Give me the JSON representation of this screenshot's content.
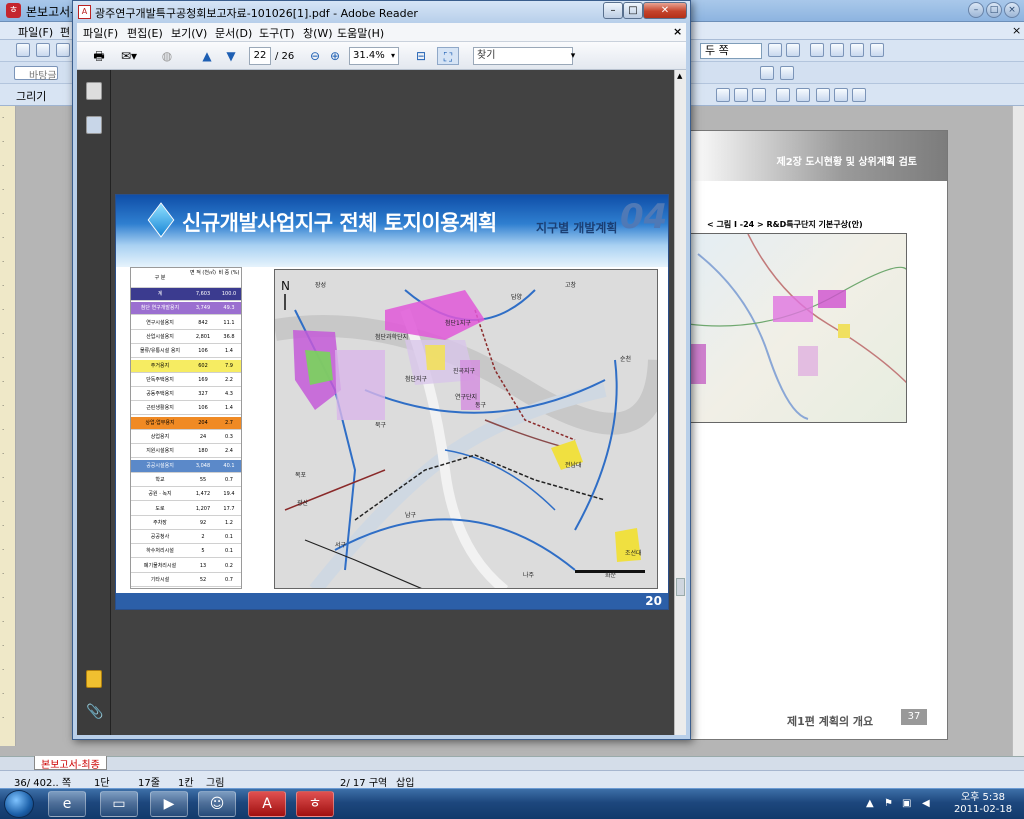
{
  "hwp": {
    "title": "본보고서-",
    "menus": [
      "파일(F)",
      "편"
    ],
    "zoom_option": "두 쪽",
    "style_field": "바탕글",
    "draw_label": "그리기",
    "page_header": "제2장 도시현황 및 상위계획 검토",
    "figure_caption": "< 그림 I -24 > R&D특구단지 기본구상(안)",
    "page_footer": "제1편 계획의 개요",
    "page_number": "37",
    "sheet_tab": "본보고서-최종",
    "status": {
      "page": "36/ 402.. 쪽",
      "column": "1단",
      "line": "17줄",
      "col": "1칸",
      "object": "그림",
      "section": "2/ 17 구역",
      "mode": "삽입"
    }
  },
  "reader": {
    "title": "광주연구개발특구공청회보고자료-101026[1].pdf - Adobe Reader",
    "menus": [
      "파일(F)",
      "편집(E)",
      "보기(V)",
      "문서(D)",
      "도구(T)",
      "창(W)",
      "도움말(H)"
    ],
    "page_current": "22",
    "page_total": "/ 26",
    "zoom": "31.4%",
    "find_placeholder": "찾기",
    "close_x": "×",
    "pdf": {
      "title": "신규개발사업지구 전체 토지이용계획",
      "subtitle": "지구별 개발계획",
      "number": "04",
      "page_number": "20",
      "table_header": [
        "구 분",
        "면 적 (천㎡)",
        "비 중 (%)"
      ],
      "table_rows": [
        {
          "label": "계",
          "area": "7,603",
          "ratio": "100.0",
          "style": "total"
        },
        {
          "label": "첨단 연구개발용지",
          "area": "3,749",
          "ratio": "49.3",
          "style": "purple"
        },
        {
          "label": "연구시설용지",
          "area": "842",
          "ratio": "11.1",
          "style": "plain"
        },
        {
          "label": "산업시설용지",
          "area": "2,801",
          "ratio": "36.8",
          "style": "plain"
        },
        {
          "label": "물류/유통시설 용지",
          "area": "106",
          "ratio": "1.4",
          "style": "plain"
        },
        {
          "label": "주거용지",
          "area": "602",
          "ratio": "7.9",
          "style": "yellow"
        },
        {
          "label": "단독주택용지",
          "area": "169",
          "ratio": "2.2",
          "style": "plain"
        },
        {
          "label": "공동주택용지",
          "area": "327",
          "ratio": "4.3",
          "style": "plain"
        },
        {
          "label": "근린생활용지",
          "area": "106",
          "ratio": "1.4",
          "style": "plain"
        },
        {
          "label": "상업·업무용지",
          "area": "204",
          "ratio": "2.7",
          "style": "orange"
        },
        {
          "label": "상업용지",
          "area": "24",
          "ratio": "0.3",
          "style": "plain"
        },
        {
          "label": "지원시설용지",
          "area": "180",
          "ratio": "2.4",
          "style": "plain"
        },
        {
          "label": "공공시설용지",
          "area": "3,048",
          "ratio": "40.1",
          "style": "blue"
        },
        {
          "label": "학교",
          "area": "55",
          "ratio": "0.7",
          "style": "plain"
        },
        {
          "label": "공원 · 녹지",
          "area": "1,472",
          "ratio": "19.4",
          "style": "plain"
        },
        {
          "label": "도로",
          "area": "1,207",
          "ratio": "17.7",
          "style": "plain"
        },
        {
          "label": "주차장",
          "area": "92",
          "ratio": "1.2",
          "style": "plain"
        },
        {
          "label": "공공청사",
          "area": "2",
          "ratio": "0.1",
          "style": "plain"
        },
        {
          "label": "하수처리시설",
          "area": "5",
          "ratio": "0.1",
          "style": "plain"
        },
        {
          "label": "폐기물처리시설",
          "area": "13",
          "ratio": "0.2",
          "style": "plain"
        },
        {
          "label": "기타시설",
          "area": "52",
          "ratio": "0.7",
          "style": "plain"
        }
      ],
      "map_labels": [
        "첨단과학단지",
        "첨단1지구",
        "첨단지구",
        "진곡지구",
        "연구단지",
        "담양",
        "고창",
        "순천",
        "화순",
        "목포",
        "나주",
        "장성",
        "광산",
        "북구",
        "동구",
        "서구",
        "남구",
        "전남대",
        "조선대"
      ]
    }
  },
  "taskbar": {
    "time": "오후 5:38",
    "date": "2011-02-18"
  },
  "colors": {
    "table_total": "#3b3b8f",
    "table_purple": "#9b6fd0",
    "table_yellow": "#f6ec62",
    "table_orange": "#f08a24",
    "table_blue": "#5b89c9",
    "pdf_footer": "#2c5fa8"
  }
}
